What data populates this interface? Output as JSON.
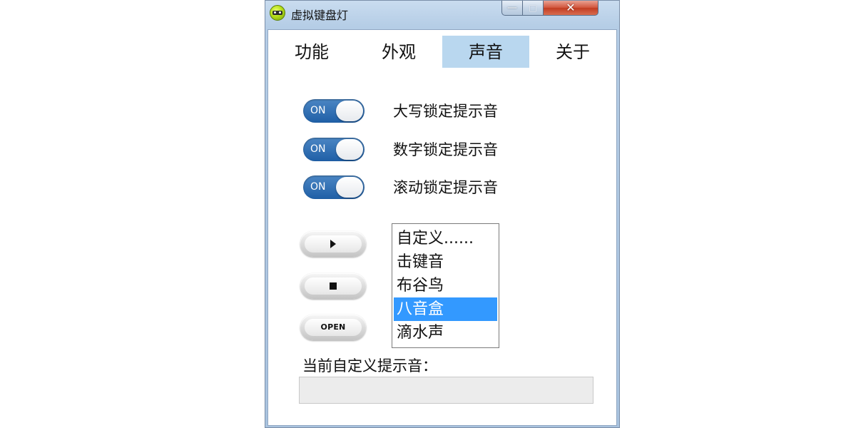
{
  "window": {
    "title": "虚拟键盘灯",
    "app_icon": "keyboard-led-app-icon",
    "caption_buttons": {
      "minimize": "—",
      "maximize": "□",
      "close": "✕"
    }
  },
  "tabs": [
    {
      "label": "功能",
      "active": false
    },
    {
      "label": "外观",
      "active": false
    },
    {
      "label": "声音",
      "active": true
    },
    {
      "label": "关于",
      "active": false
    }
  ],
  "toggles": [
    {
      "state": "ON",
      "label": "大写锁定提示音"
    },
    {
      "state": "ON",
      "label": "数字锁定提示音"
    },
    {
      "state": "ON",
      "label": "滚动锁定提示音"
    }
  ],
  "player_buttons": {
    "play": "play-icon",
    "stop": "stop-icon",
    "open_label": "OPEN"
  },
  "sound_list": {
    "items": [
      "自定义......",
      "击键音",
      "布谷鸟",
      "八音盒",
      "滴水声"
    ],
    "selected_index": 3
  },
  "current_custom": {
    "label": "当前自定义提示音：",
    "value": ""
  },
  "colors": {
    "accent_toggle": "#2a68ad",
    "active_tab": "#b9d7ef",
    "selection": "#3399ff",
    "close_button": "#c94a2f"
  }
}
